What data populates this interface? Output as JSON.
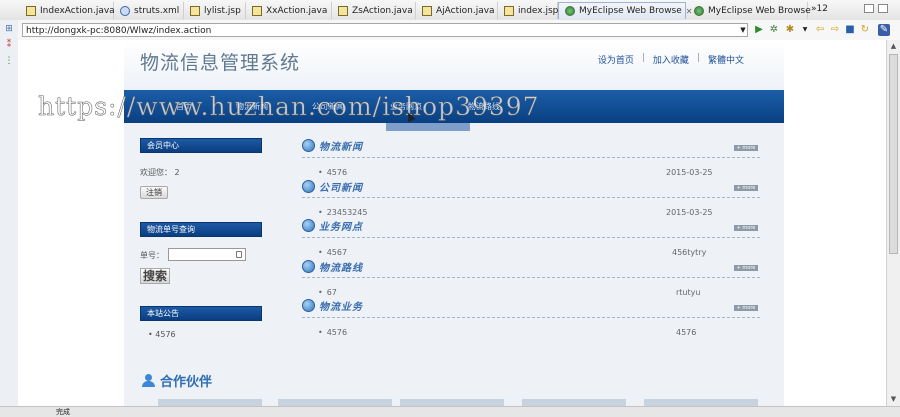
{
  "editor_tabs": [
    {
      "label": "IndexAction.java",
      "icon": "java-file-icon"
    },
    {
      "label": "struts.xml",
      "icon": "xml-file-icon"
    },
    {
      "label": "lylist.jsp",
      "icon": "jsp-file-icon"
    },
    {
      "label": "XxAction.java",
      "icon": "java-file-icon"
    },
    {
      "label": "ZsAction.java",
      "icon": "java-file-icon"
    },
    {
      "label": "AjAction.java",
      "icon": "java-file-icon"
    },
    {
      "label": "index.jsp",
      "icon": "jsp-file-icon"
    },
    {
      "label": "MyEclipse Web Browse",
      "icon": "globe-icon",
      "active": true,
      "close": "✕"
    },
    {
      "label": "MyEclipse Web Browse",
      "icon": "globe-icon"
    }
  ],
  "tab_overflow": "»12",
  "address": {
    "url": "http://dongxk-pc:8080/Wlwz/index.action"
  },
  "site": {
    "title": "物流信息管理系统",
    "top_links": [
      "设为首页",
      "加入收藏",
      "繁體中文"
    ],
    "nav_items": [
      "首页",
      "物流新闻",
      "公司新闻",
      "业务网点",
      "物流路线"
    ]
  },
  "watermark": "https://www.huzhan.com/ishop39397",
  "sidebar": {
    "member_title": "会员中心",
    "welcome_label": "欢迎您：",
    "welcome_user": "2",
    "logout_btn": "注销",
    "query_title": "物流单号查询",
    "no_label": "单号：",
    "search_btn": "搜索",
    "notice_title": "本站公告",
    "notice_item": "4576"
  },
  "sections": [
    {
      "title": "物流新闻",
      "item": "4576",
      "date": "2015-03-25",
      "more": "+ more"
    },
    {
      "title": "公司新闻",
      "item": "23453245",
      "date": "2015-03-25",
      "more": "+ more"
    },
    {
      "title": "业务网点",
      "item": "4567",
      "date": "456tytry",
      "more": "+ more"
    },
    {
      "title": "物流路线",
      "item": "67",
      "date": "rtutyu",
      "more": "+ more"
    },
    {
      "title": "物流业务",
      "item": "4576",
      "date": "4576",
      "more": "+ more"
    }
  ],
  "partner_title": "合作伙伴",
  "status_text": "完成"
}
